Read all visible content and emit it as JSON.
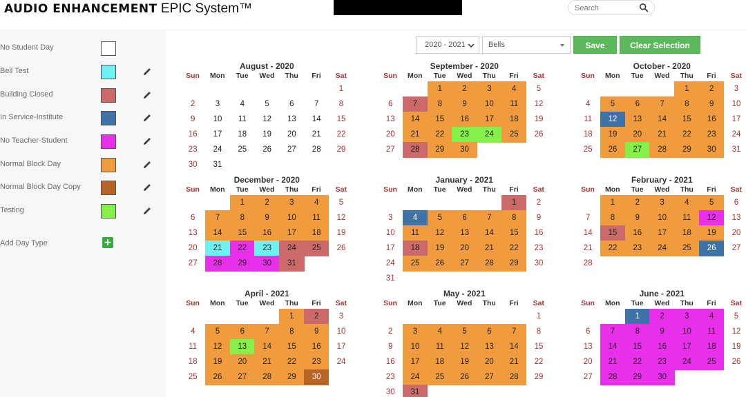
{
  "header": {
    "brand_main": "AUDIO ENHANCEMENT",
    "brand_product": "EPIC System™",
    "search_placeholder": "Search"
  },
  "colors": {
    "no_student_day": "#ffffff",
    "bell_test": "#6ff0f2",
    "building_closed": "#cc6a6a",
    "in_service_institute": "#3f73a8",
    "no_teacher_student": "#e830ea",
    "normal_block_day": "#f09c3e",
    "normal_block_day_copy": "#b86528",
    "testing": "#86f04a"
  },
  "legend": [
    {
      "label": "No Student Day",
      "color_key": "no_student_day",
      "editable": false
    },
    {
      "label": "Bell Test",
      "color_key": "bell_test",
      "editable": true
    },
    {
      "label": "Building Closed",
      "color_key": "building_closed",
      "editable": true
    },
    {
      "label": "In Service-Institute",
      "color_key": "in_service_institute",
      "editable": true
    },
    {
      "label": "No Teacher-Student",
      "color_key": "no_teacher_student",
      "editable": true
    },
    {
      "label": "Normal Block Day",
      "color_key": "normal_block_day",
      "editable": true
    },
    {
      "label": "Normal Block Day Copy",
      "color_key": "normal_block_day_copy",
      "editable": true
    },
    {
      "label": "Testing",
      "color_key": "testing",
      "editable": true
    }
  ],
  "add_day_type_label": "Add Day Type",
  "controls": {
    "year_value": "2020 - 2021",
    "bells_value": "Bells",
    "save_label": "Save",
    "clear_label": "Clear Selection"
  },
  "weekdays": [
    "Sun",
    "Mon",
    "Tue",
    "Wed",
    "Thu",
    "Fri",
    "Sat"
  ],
  "months": [
    {
      "title": "August - 2020",
      "start": 6,
      "days": 31,
      "default": "none",
      "overrides": {}
    },
    {
      "title": "September - 2020",
      "start": 2,
      "days": 30,
      "default": "normal_block_day",
      "overrides": {
        "7": "building_closed",
        "23": "testing",
        "24": "testing",
        "28": "building_closed"
      }
    },
    {
      "title": "October - 2020",
      "start": 4,
      "days": 31,
      "default": "normal_block_day",
      "overrides": {
        "12": "in_service_institute",
        "27": "testing"
      }
    },
    {
      "title": "December - 2020",
      "start": 2,
      "days": 31,
      "default": "normal_block_day",
      "overrides": {
        "21": "bell_test",
        "22": "no_teacher_student",
        "23": "bell_test",
        "24": "building_closed",
        "25": "building_closed",
        "28": "no_teacher_student",
        "29": "no_teacher_student",
        "30": "no_teacher_student",
        "31": "building_closed"
      }
    },
    {
      "title": "January - 2021",
      "start": 5,
      "days": 31,
      "default": "normal_block_day",
      "overrides": {
        "1": "building_closed",
        "4": "in_service_institute",
        "18": "building_closed"
      }
    },
    {
      "title": "February - 2021",
      "start": 1,
      "days": 28,
      "default": "normal_block_day",
      "overrides": {
        "12": "no_teacher_student",
        "15": "building_closed",
        "26": "in_service_institute"
      }
    },
    {
      "title": "April - 2021",
      "start": 4,
      "days": 30,
      "default": "normal_block_day",
      "overrides": {
        "2": "building_closed",
        "13": "testing",
        "30": "normal_block_day_copy"
      }
    },
    {
      "title": "May - 2021",
      "start": 6,
      "days": 31,
      "default": "normal_block_day",
      "overrides": {
        "31": "building_closed"
      }
    },
    {
      "title": "June - 2021",
      "start": 2,
      "days": 30,
      "default": "no_teacher_student",
      "overrides": {
        "1": "in_service_institute"
      }
    }
  ]
}
